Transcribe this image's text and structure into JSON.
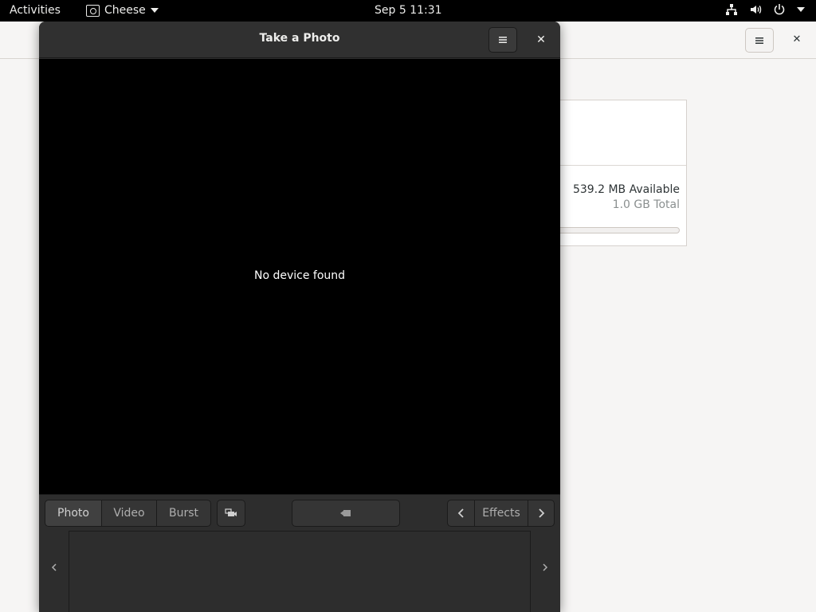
{
  "topbar": {
    "activities": "Activities",
    "app_name": "Cheese",
    "clock": "Sep 5  11:31",
    "icons": [
      "network-icon",
      "volume-icon",
      "power-icon",
      "chevron-down-icon"
    ]
  },
  "background_window": {
    "storage": {
      "available": "539.2 MB Available",
      "total": "1.0 GB Total"
    }
  },
  "cheese": {
    "title": "Take a Photo",
    "viewport_message": "No device found",
    "modes": [
      "Photo",
      "Video",
      "Burst"
    ],
    "selected_mode": "Photo",
    "effects_label": "Effects"
  },
  "colors": {
    "topbar_bg": "#000000",
    "window_bg": "#2d2d2d",
    "viewport_bg": "#000000",
    "background_window_bg": "#f6f5f4"
  }
}
